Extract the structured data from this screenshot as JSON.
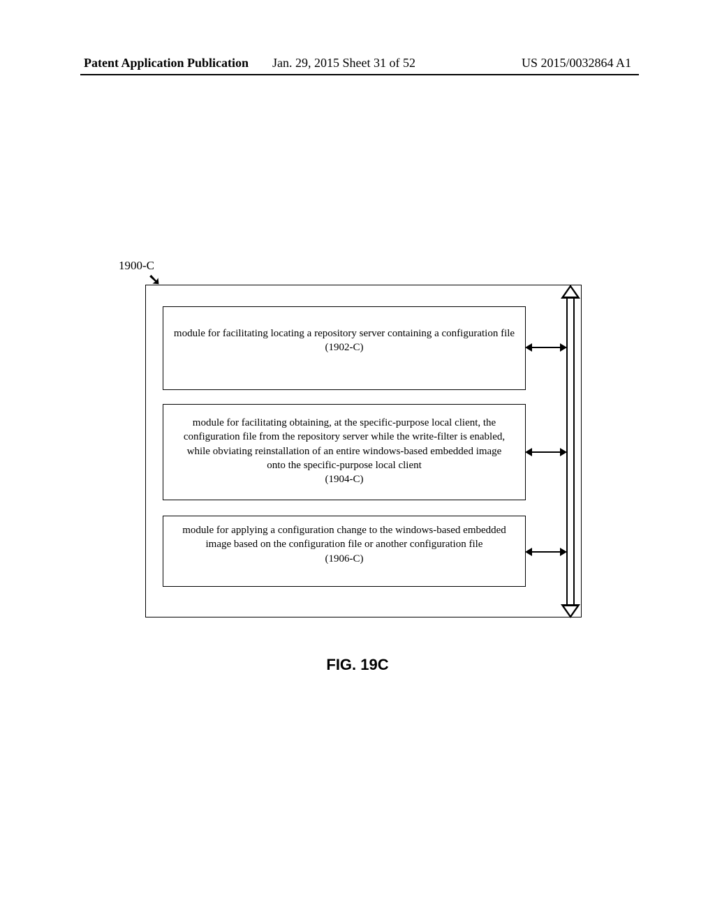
{
  "header": {
    "left": "Patent Application Publication",
    "mid": "Jan. 29, 2015  Sheet 31 of 52",
    "right": "US 2015/0032864 A1"
  },
  "ref_label": "1900-C",
  "modules": {
    "m1": {
      "text": "module for facilitating locating a repository server containing a configuration file",
      "id": "(1902-C)"
    },
    "m2": {
      "text": "module for facilitating obtaining, at the specific-purpose local client, the configuration file from the repository server while the write-filter is enabled, while obviating reinstallation of an entire windows-based embedded image onto the specific-purpose local client",
      "id": "(1904-C)"
    },
    "m3": {
      "text": "module for applying a configuration change to the windows-based embedded image based on the configuration file or another configuration file",
      "id": "(1906-C)"
    }
  },
  "figure_label": "FIG. 19C"
}
